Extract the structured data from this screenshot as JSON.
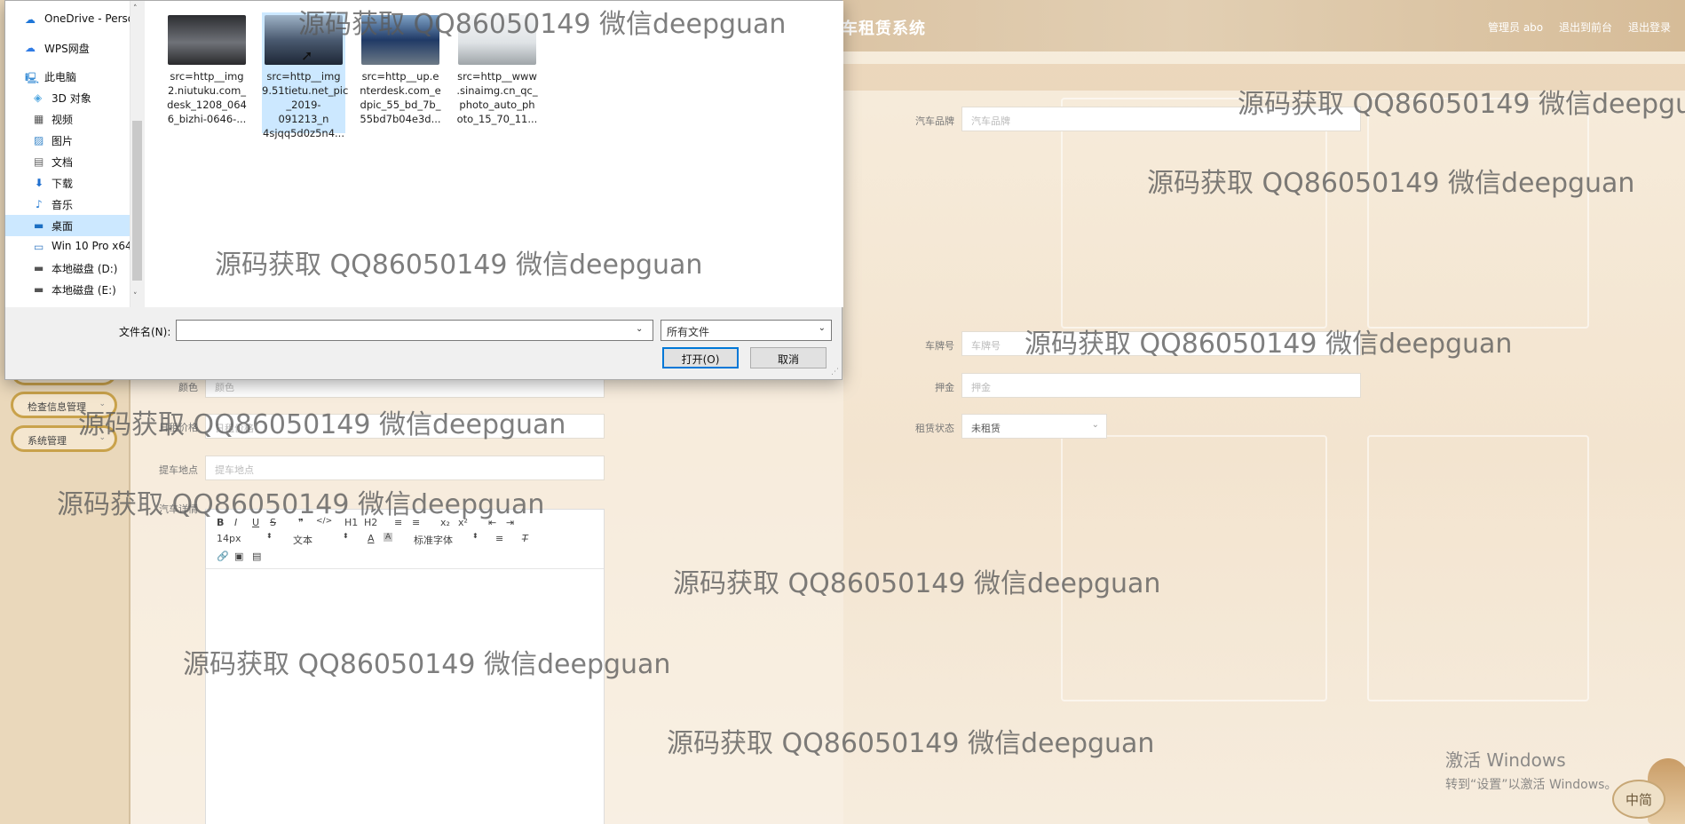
{
  "app": {
    "title_fragment": "车租赁系统",
    "top_links": [
      "管理员 abo",
      "退出到前台",
      "退出登录"
    ]
  },
  "sidebar": {
    "items": [
      {
        "label": "检查信息管理"
      },
      {
        "label": "系统管理"
      }
    ]
  },
  "form": {
    "brand": {
      "label": "汽车品牌",
      "placeholder": "汽车品牌"
    },
    "plate": {
      "label": "车牌号",
      "placeholder": "车牌号"
    },
    "deposit": {
      "label": "押金",
      "placeholder": "押金"
    },
    "status": {
      "label": "租赁状态",
      "value": "未租赁"
    },
    "color": {
      "label": "颜色",
      "placeholder": "颜色"
    },
    "daily": {
      "label": "日租价格",
      "placeholder": "日租价格"
    },
    "pickup": {
      "label": "提车地点",
      "placeholder": "提车地点"
    },
    "detail": {
      "label": "汽车详情"
    }
  },
  "editor": {
    "row1": [
      "B",
      "I",
      "U",
      "S",
      "❞",
      "</>",
      "H1",
      "H2",
      "≡",
      "≡",
      "x₂",
      "x²",
      "⇤",
      "⇥"
    ],
    "font_size": "14px",
    "block_type": "文本",
    "font_family": "标准字体"
  },
  "dialog": {
    "nav": [
      {
        "icon": "cloud-icon",
        "label": "OneDrive - Personal"
      },
      {
        "icon": "cloud-icon",
        "label": "WPS网盘"
      },
      {
        "icon": "computer-icon",
        "label": "此电脑"
      },
      {
        "icon": "cube-icon",
        "label": "3D 对象"
      },
      {
        "icon": "video-icon",
        "label": "视频"
      },
      {
        "icon": "picture-icon",
        "label": "图片"
      },
      {
        "icon": "document-icon",
        "label": "文档"
      },
      {
        "icon": "download-icon",
        "label": "下载"
      },
      {
        "icon": "music-icon",
        "label": "音乐"
      },
      {
        "icon": "desktop-icon",
        "label": "桌面"
      },
      {
        "icon": "system-drive-icon",
        "label": "Win 10 Pro x64"
      },
      {
        "icon": "drive-icon",
        "label": "本地磁盘 (D:)"
      },
      {
        "icon": "drive-icon",
        "label": "本地磁盘 (E:)"
      }
    ],
    "files": [
      {
        "name": "src=http__img\n2.niutuku.com_\ndesk_1208_064\n6_bizhi-0646-...",
        "color": "#6f7278"
      },
      {
        "name": "src=http__img\n9.51tietu.net_pic\n_2019-091213_n\n4sjqq5d0z5n4...",
        "color": "#4a5a70"
      },
      {
        "name": "src=http__up.e\nnterdesk.com_e\ndpic_55_bd_7b_\n55bd7b04e3d...",
        "color": "#203a66"
      },
      {
        "name": "src=http__www\n.sinaimg.cn_qc_\nphoto_auto_ph\noto_15_70_11...",
        "color": "#dfe3e6"
      }
    ],
    "filename_label": "文件名(N):",
    "filename_value": "",
    "filetype": "所有文件",
    "open_button": "打开(O)",
    "cancel_button": "取消"
  },
  "watermark": "源码获取 QQ86050149 微信deepguan",
  "os": {
    "activate_title": "激活 Windows",
    "activate_sub": "转到“设置”以激活 Windows。",
    "ime": "中简"
  }
}
